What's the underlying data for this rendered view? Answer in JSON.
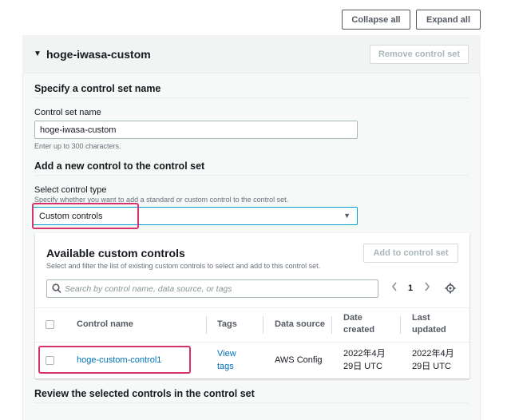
{
  "toolbar": {
    "collapse_all": "Collapse all",
    "expand_all": "Expand all"
  },
  "panel": {
    "title": "hoge-iwasa-custom",
    "remove_button": "Remove control set",
    "name_section": {
      "heading": "Specify a control set name",
      "label": "Control set name",
      "value": "hoge-iwasa-custom",
      "hint": "Enter up to 300 characters."
    },
    "add_section": {
      "heading": "Add a new control to the control set",
      "type_label": "Select control type",
      "type_desc": "Specify whether you want to add a standard or custom control to the control set.",
      "selected": "Custom controls"
    },
    "available": {
      "title": "Available custom controls",
      "desc": "Select and filter the list of existing custom controls to select and add to this control set.",
      "add_button": "Add to control set",
      "search_placeholder": "Search by control name, data source, or tags",
      "page": "1",
      "columns": {
        "name": "Control name",
        "tags": "Tags",
        "source": "Data source",
        "created_1": "Date",
        "created_2": "created",
        "updated_1": "Last",
        "updated_2": "updated"
      },
      "rows": [
        {
          "name": "hoge-custom-control1",
          "tags_1": "View",
          "tags_2": "tags",
          "source": "AWS Config",
          "created_1": "2022年4月",
          "created_2": "29日 UTC",
          "updated_1": "2022年4月",
          "updated_2": "29日 UTC"
        }
      ]
    },
    "review_heading": "Review the selected controls in the control set"
  },
  "colors": {
    "link": "#0073bb",
    "highlight": "#d6336c",
    "focus": "#00a1c9"
  }
}
